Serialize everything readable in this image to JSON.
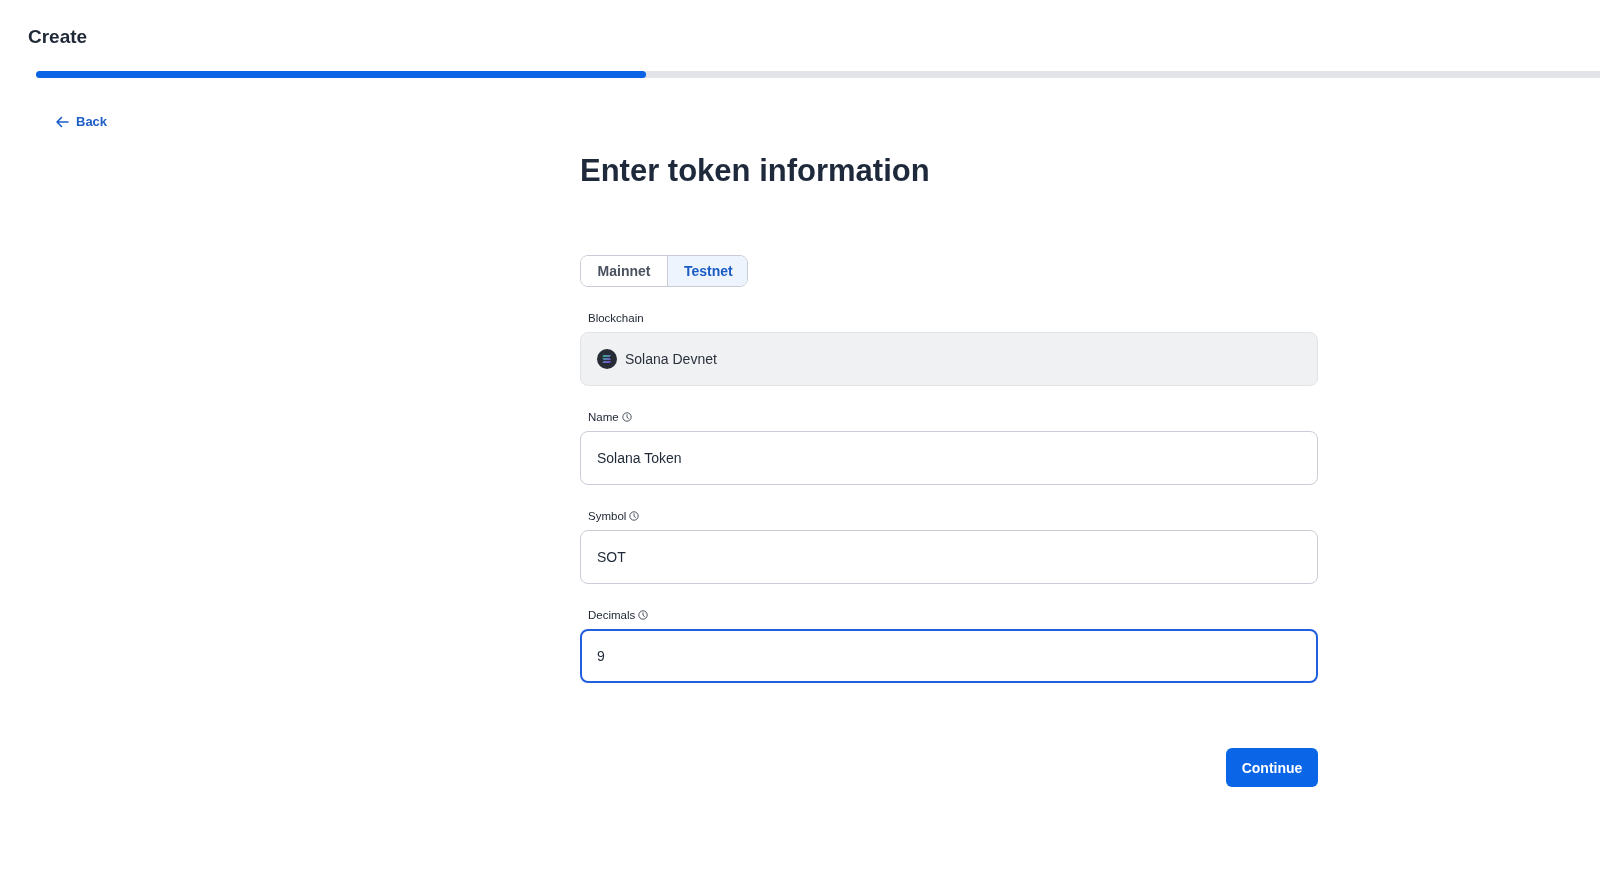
{
  "header": {
    "title": "Create"
  },
  "progress": {
    "level": 0.39
  },
  "back_link": {
    "label": "Back"
  },
  "heading": "Enter token information",
  "network_tabs": [
    {
      "label": "Mainnet",
      "selected": false
    },
    {
      "label": "Testnet",
      "selected": true
    }
  ],
  "fields": [
    {
      "kind": "chain",
      "label": "Blockchain",
      "info": false,
      "value": "Solana Devnet",
      "disabled": true,
      "focused": false
    },
    {
      "kind": "text",
      "label": "Name",
      "info": true,
      "value": "Solana Token",
      "disabled": false,
      "focused": false
    },
    {
      "kind": "text",
      "label": "Symbol",
      "info": true,
      "value": "SOT",
      "disabled": false,
      "focused": false
    },
    {
      "kind": "text",
      "label": "Decimals",
      "info": true,
      "value": "9",
      "disabled": false,
      "focused": true
    }
  ],
  "continue_button": {
    "label": "Continue"
  }
}
